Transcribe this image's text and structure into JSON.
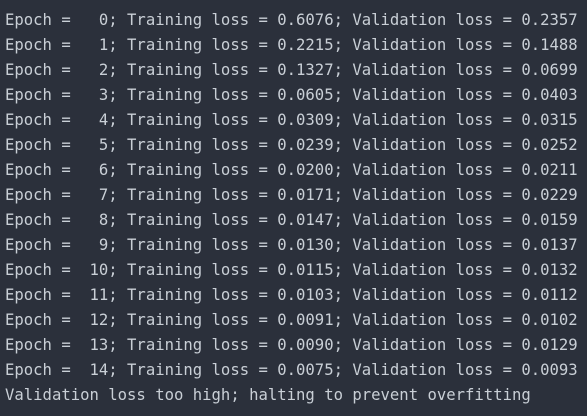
{
  "console": {
    "lines": [
      "Epoch =   0; Training loss = 0.6076; Validation loss = 0.2357",
      "Epoch =   1; Training loss = 0.2215; Validation loss = 0.1488",
      "Epoch =   2; Training loss = 0.1327; Validation loss = 0.0699",
      "Epoch =   3; Training loss = 0.0605; Validation loss = 0.0403",
      "Epoch =   4; Training loss = 0.0309; Validation loss = 0.0315",
      "Epoch =   5; Training loss = 0.0239; Validation loss = 0.0252",
      "Epoch =   6; Training loss = 0.0200; Validation loss = 0.0211",
      "Epoch =   7; Training loss = 0.0171; Validation loss = 0.0229",
      "Epoch =   8; Training loss = 0.0147; Validation loss = 0.0159",
      "Epoch =   9; Training loss = 0.0130; Validation loss = 0.0137",
      "Epoch =  10; Training loss = 0.0115; Validation loss = 0.0132",
      "Epoch =  11; Training loss = 0.0103; Validation loss = 0.0112",
      "Epoch =  12; Training loss = 0.0091; Validation loss = 0.0102",
      "Epoch =  13; Training loss = 0.0090; Validation loss = 0.0129",
      "Epoch =  14; Training loss = 0.0075; Validation loss = 0.0093",
      "Validation loss too high; halting to prevent overfitting"
    ]
  },
  "colors": {
    "background": "#2b303b",
    "text": "#c9cfd6"
  }
}
